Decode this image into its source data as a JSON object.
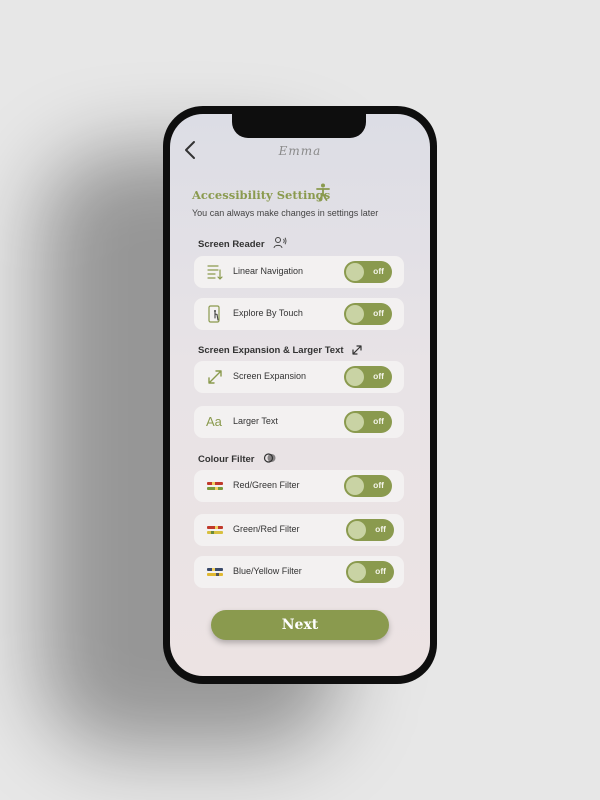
{
  "header": {
    "logo_text": "Emma"
  },
  "intro": {
    "title": "Accessibility Settings",
    "subtitle": "You can always make changes in settings later"
  },
  "sections": [
    {
      "label": "Screen Reader",
      "icon": "person-voice-icon",
      "items": [
        {
          "label": "Linear Navigation",
          "icon": "linear-navigation-icon",
          "toggle": "off"
        },
        {
          "label": "Explore By Touch",
          "icon": "touch-phone-icon",
          "toggle": "off"
        }
      ]
    },
    {
      "label": "Screen Expansion & Larger Text",
      "icon": "expand-arrows-icon",
      "items": [
        {
          "label": "Screen Expansion",
          "icon": "expand-arrows-icon",
          "toggle": "off"
        },
        {
          "label": "Larger Text",
          "icon": "text-size-icon",
          "glyph": "Aa",
          "toggle": "off"
        }
      ]
    },
    {
      "label": "Colour Filter",
      "icon": "colour-filter-icon",
      "items": [
        {
          "label": "Red/Green Filter",
          "icon": "red-green-crayons-icon",
          "toggle": "off"
        },
        {
          "label": "Green/Red Filter",
          "icon": "green-red-crayons-icon",
          "toggle": "off"
        },
        {
          "label": "Blue/Yellow Filter",
          "icon": "blue-yellow-crayons-icon",
          "toggle": "off"
        }
      ]
    }
  ],
  "footer": {
    "next_label": "Next"
  },
  "colors": {
    "accent": "#8a9a4e",
    "toggle_knob": "#c9d3a4",
    "row_bg": "#f3f1f1"
  }
}
